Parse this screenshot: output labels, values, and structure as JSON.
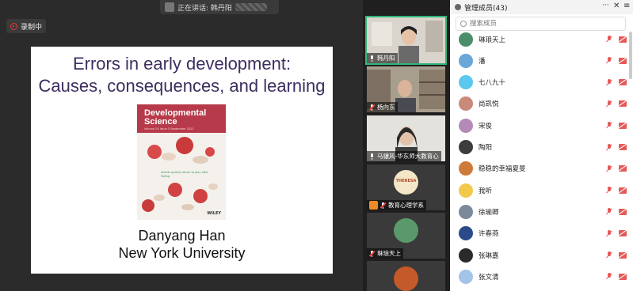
{
  "stage": {
    "speaking_label": "正在讲话: 韩丹阳",
    "recording_label": "录制中",
    "slide": {
      "title_line1": "Errors in early development:",
      "title_line2": "Causes, consequences, and learning",
      "cover_journal_line1": "Developmental",
      "cover_journal_line2": "Science",
      "cover_meta": "Volume 24   Issue 5   September 2021",
      "cover_caption": "Infants quickly return to play after Falling",
      "cover_publisher": "WILEY",
      "author": "Danyang Han",
      "affiliation": "New York University"
    }
  },
  "thumbnails": [
    {
      "name": "韩丹阳",
      "mic": "on",
      "active": true
    },
    {
      "name": "杨向东",
      "mic": "off",
      "active": false
    },
    {
      "name": "马骧风-华东师大教育心",
      "mic": "on",
      "active": false
    },
    {
      "name": "教育心理学系",
      "mic": "off",
      "active": false,
      "badge": "THERESA"
    },
    {
      "name": "琳琅天上",
      "mic": "off",
      "active": false
    },
    {
      "name": "",
      "mic": "off",
      "active": false
    }
  ],
  "panel": {
    "title": "管理成员(43)",
    "more_label": "···",
    "close_label": "✕",
    "menu_label": "≡",
    "search_placeholder": "搜索成员",
    "members": [
      {
        "name": "琳琅天上",
        "color": "#4a8f6a"
      },
      {
        "name": "潘",
        "color": "#6aa6d8"
      },
      {
        "name": "七八九十",
        "color": "#5bc8f0"
      },
      {
        "name": "尚凯悦",
        "color": "#c98a7a"
      },
      {
        "name": "宋俊",
        "color": "#b48ab8"
      },
      {
        "name": "陶阳",
        "color": "#3d3d3d"
      },
      {
        "name": "稳稳的幸福夏旻",
        "color": "#d07a3a"
      },
      {
        "name": "我听",
        "color": "#f2c94c"
      },
      {
        "name": "徐瑜卿",
        "color": "#7a8a9a"
      },
      {
        "name": "许春燕",
        "color": "#2b4a8a"
      },
      {
        "name": "张琳嘉",
        "color": "#2a2a2a"
      },
      {
        "name": "张文清",
        "color": "#a3c4e8"
      }
    ]
  }
}
